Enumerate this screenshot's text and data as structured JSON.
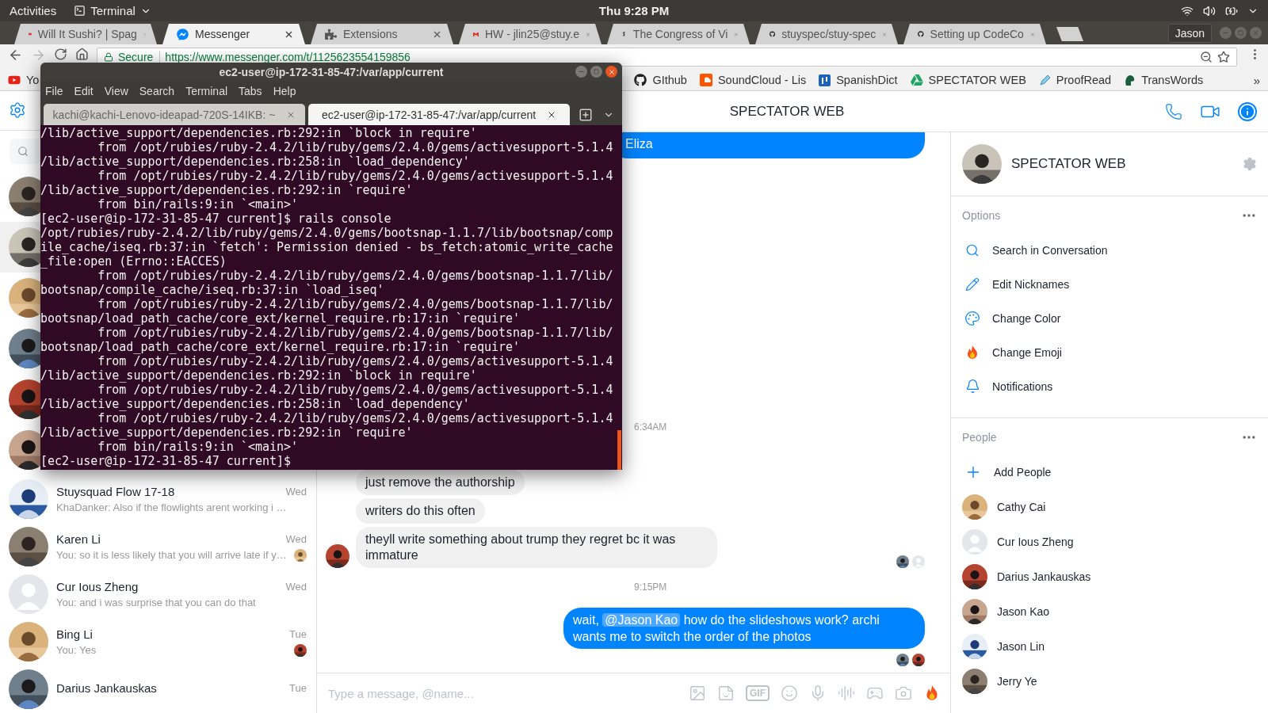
{
  "top_bar": {
    "activities": "Activities",
    "app_menu": "Terminal",
    "clock": "Thu 9:28 PM"
  },
  "browser": {
    "tabs": [
      {
        "title": "Will It Sushi? | Spag",
        "selected": false
      },
      {
        "title": "Messenger",
        "selected": true
      },
      {
        "title": "Extensions",
        "selected": false
      },
      {
        "title": "HW - jlin25@stuy.e",
        "selected": false
      },
      {
        "title": "The Congress of Vi",
        "selected": false
      },
      {
        "title": "stuyspec/stuy-spec",
        "selected": false
      },
      {
        "title": "Setting up CodeCo",
        "selected": false
      }
    ],
    "profile": "Jason",
    "address_bar": {
      "secure": "Secure",
      "url": "https://www.messenger.com/t/1125623554159856"
    },
    "bookmarks": [
      "Yo",
      "GIthub",
      "SoundCloud - Lis",
      "SpanishDict",
      "SPECTATOR WEB",
      "ProofRead",
      "TransWords"
    ],
    "bookmarks_more": "»"
  },
  "sidebar": {
    "conversations": [
      {
        "selected": false,
        "default_avatar": false
      },
      {
        "selected": true,
        "default_avatar": false
      },
      {
        "selected": false,
        "default_avatar": false
      },
      {
        "selected": false,
        "default_avatar": false
      },
      {
        "selected": false,
        "default_avatar": false
      },
      {
        "selected": false,
        "default_avatar": false
      },
      {
        "selected": false,
        "default_avatar": false,
        "name": "Stuysquad Flow 17-18",
        "time": "Wed",
        "preview": "KhaDanker: Also if the flowlights arent working i …",
        "seen": false
      },
      {
        "selected": false,
        "default_avatar": false,
        "name": "Karen Li",
        "time": "Wed",
        "preview": "You: so it is less likely that you will arrive late if y…",
        "seen": true
      },
      {
        "selected": false,
        "default_avatar": true,
        "name": "Cur Ious Zheng",
        "time": "Wed",
        "preview": "You: and i was surprise that you can do that",
        "seen": false
      },
      {
        "selected": false,
        "default_avatar": false,
        "name": "Bing Li",
        "time": "Tue",
        "preview": "You: Yes",
        "seen": true
      },
      {
        "selected": false,
        "default_avatar": false,
        "name": "Darius Jankauskas",
        "time": "Tue",
        "seen": false
      }
    ]
  },
  "chat": {
    "title": "SPECTATOR WEB",
    "messages": [
      {
        "kind": "outgoing",
        "parts": [
          {
            "text": "Eliza",
            "mention": false
          }
        ]
      },
      {
        "kind": "time",
        "text": "6:34AM"
      },
      {
        "kind": "incoming",
        "texts": [
          "just remove the authorship",
          "writers do this often",
          "theyll write something about trump they regret bc it was immature"
        ],
        "seen_by": [
          {
            "default_avatar": false
          },
          {
            "default_avatar": true
          }
        ]
      },
      {
        "kind": "time",
        "text": "9:15PM"
      },
      {
        "kind": "outgoing",
        "parts": [
          {
            "text": "wait, ",
            "mention": false
          },
          {
            "text": "@Jason Kao",
            "mention": true
          },
          {
            "text": " how do the slideshows work? archi wants me to switch the order of the photos",
            "mention": false
          }
        ],
        "seen_by": [
          {
            "default_avatar": false
          },
          {
            "default_avatar": false
          }
        ]
      }
    ],
    "composer": {
      "placeholder": "Type a message, @name...",
      "gif": "GIF"
    }
  },
  "info_panel": {
    "name": "SPECTATOR WEB",
    "options_label": "Options",
    "options": [
      "Search in Conversation",
      "Edit Nicknames",
      "Change Color",
      "Change Emoji",
      "Notifications"
    ],
    "people_label": "People",
    "add_people": "Add People",
    "people": [
      {
        "name": "Cathy Cai",
        "default_avatar": false
      },
      {
        "name": "Cur Ious Zheng",
        "default_avatar": true
      },
      {
        "name": "Darius Jankauskas",
        "default_avatar": false
      },
      {
        "name": "Jason Kao",
        "default_avatar": false
      },
      {
        "name": "Jason Lin",
        "default_avatar": false
      },
      {
        "name": "Jerry Ye",
        "default_avatar": false
      }
    ]
  },
  "terminal": {
    "title": "ec2-user@ip-172-31-85-47:/var/app/current",
    "menu": [
      "File",
      "Edit",
      "View",
      "Search",
      "Terminal",
      "Tabs",
      "Help"
    ],
    "tabs": [
      {
        "title": "kachi@kachi-Lenovo-ideapad-720S-14IKB: ~",
        "selected": false
      },
      {
        "title": "ec2-user@ip-172-31-85-47:/var/app/current",
        "selected": true
      }
    ],
    "lines": [
      {
        "text": "/lib/active_support/dependencies.rb:292:in `block in require'",
        "indented": false
      },
      {
        "text": "from /opt/rubies/ruby-2.4.2/lib/ruby/gems/2.4.0/gems/activesupport-5.1.4",
        "indented": true
      },
      {
        "text": "/lib/active_support/dependencies.rb:258:in `load_dependency'",
        "indented": false
      },
      {
        "text": "from /opt/rubies/ruby-2.4.2/lib/ruby/gems/2.4.0/gems/activesupport-5.1.4",
        "indented": true
      },
      {
        "text": "/lib/active_support/dependencies.rb:292:in `require'",
        "indented": false
      },
      {
        "text": "from bin/rails:9:in `<main>'",
        "indented": true
      },
      {
        "text": "[ec2-user@ip-172-31-85-47 current]$ rails console",
        "indented": false
      },
      {
        "text": "/opt/rubies/ruby-2.4.2/lib/ruby/gems/2.4.0/gems/bootsnap-1.1.7/lib/bootsnap/comp",
        "indented": false
      },
      {
        "text": "ile_cache/iseq.rb:37:in `fetch': Permission denied - bs_fetch:atomic_write_cache",
        "indented": false
      },
      {
        "text": "_file:open (Errno::EACCES)",
        "indented": false
      },
      {
        "text": "from /opt/rubies/ruby-2.4.2/lib/ruby/gems/2.4.0/gems/bootsnap-1.1.7/lib/",
        "indented": true
      },
      {
        "text": "bootsnap/compile_cache/iseq.rb:37:in `load_iseq'",
        "indented": false
      },
      {
        "text": "from /opt/rubies/ruby-2.4.2/lib/ruby/gems/2.4.0/gems/bootsnap-1.1.7/lib/",
        "indented": true
      },
      {
        "text": "bootsnap/load_path_cache/core_ext/kernel_require.rb:17:in `require'",
        "indented": false
      },
      {
        "text": "from /opt/rubies/ruby-2.4.2/lib/ruby/gems/2.4.0/gems/bootsnap-1.1.7/lib/",
        "indented": true
      },
      {
        "text": "bootsnap/load_path_cache/core_ext/kernel_require.rb:17:in `require'",
        "indented": false
      },
      {
        "text": "from /opt/rubies/ruby-2.4.2/lib/ruby/gems/2.4.0/gems/activesupport-5.1.4",
        "indented": true
      },
      {
        "text": "/lib/active_support/dependencies.rb:292:in `block in require'",
        "indented": false
      },
      {
        "text": "from /opt/rubies/ruby-2.4.2/lib/ruby/gems/2.4.0/gems/activesupport-5.1.4",
        "indented": true
      },
      {
        "text": "/lib/active_support/dependencies.rb:258:in `load_dependency'",
        "indented": false
      },
      {
        "text": "from /opt/rubies/ruby-2.4.2/lib/ruby/gems/2.4.0/gems/activesupport-5.1.4",
        "indented": true
      },
      {
        "text": "/lib/active_support/dependencies.rb:292:in `require'",
        "indented": false
      },
      {
        "text": "from bin/rails:9:in `<main>'",
        "indented": true
      },
      {
        "text": "[ec2-user@ip-172-31-85-47 current]$",
        "indented": false
      }
    ]
  }
}
